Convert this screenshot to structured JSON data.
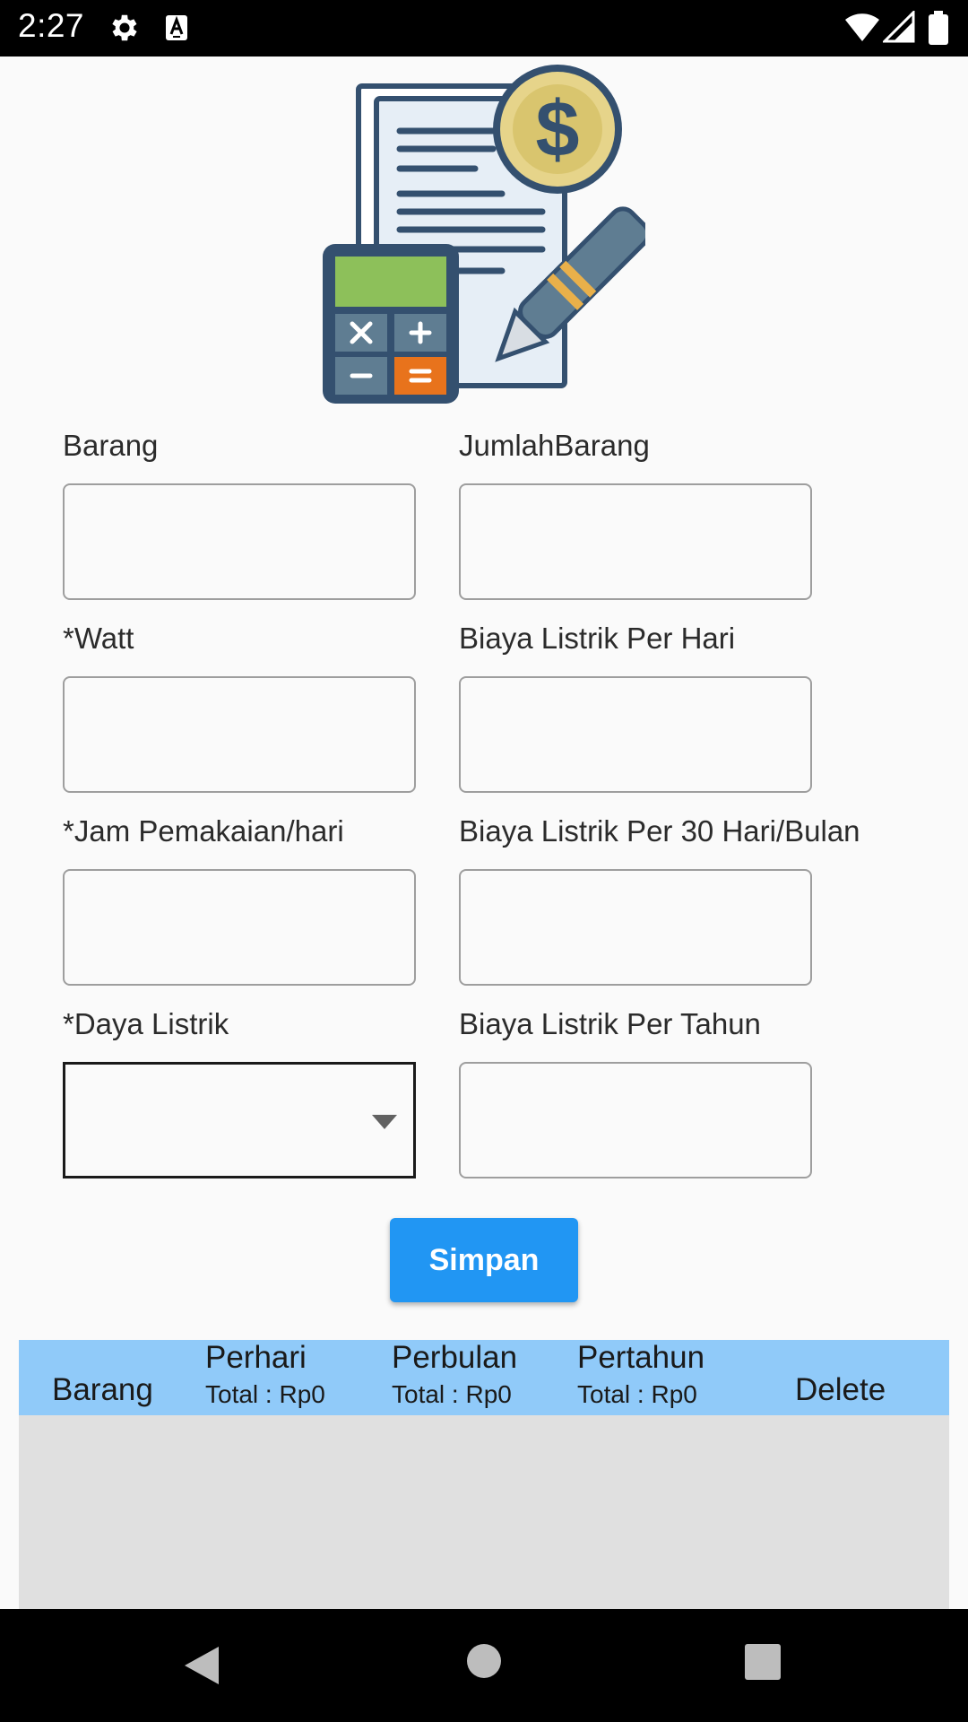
{
  "status_bar": {
    "time": "2:27",
    "icons": [
      "gear-icon",
      "keyboard-a-icon",
      "wifi-icon",
      "signal-icon",
      "battery-icon"
    ]
  },
  "form": {
    "barang_label": "Barang",
    "jumlah_barang_label": "JumlahBarang",
    "watt_label": "*Watt",
    "biaya_per_hari_label": "Biaya Listrik Per Hari",
    "jam_pemakaian_label": "*Jam Pemakaian/hari",
    "biaya_per_bulan_label": "Biaya Listrik Per 30 Hari/Bulan",
    "daya_listrik_label": "*Daya Listrik",
    "biaya_per_tahun_label": "Biaya Listrik Per Tahun",
    "barang_value": "",
    "jumlah_barang_value": "",
    "watt_value": "",
    "biaya_per_hari_value": "",
    "jam_pemakaian_value": "",
    "biaya_per_bulan_value": "",
    "daya_listrik_value": "",
    "biaya_per_tahun_value": ""
  },
  "save_button": {
    "label": "Simpan"
  },
  "table": {
    "col_barang": "Barang",
    "col_perhari": "Perhari",
    "col_perbulan": "Perbulan",
    "col_pertahun": "Pertahun",
    "col_delete": "Delete",
    "total_perhari": "Total : Rp0",
    "total_perbulan": "Total : Rp0",
    "total_pertahun": "Total : Rp0",
    "rows": []
  },
  "colors": {
    "accent": "#2196f3",
    "table_header": "#90caf9",
    "table_body": "#e0e0e0",
    "background": "#fafafa"
  }
}
